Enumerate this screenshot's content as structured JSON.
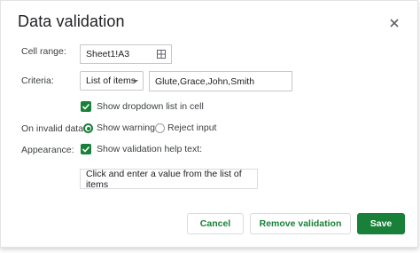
{
  "dialog": {
    "title": "Data validation",
    "close_icon": "close-icon"
  },
  "cell_range": {
    "label": "Cell range:",
    "value": "Sheet1!A3",
    "icon": "grid-icon"
  },
  "criteria": {
    "label": "Criteria:",
    "type": "List of items",
    "items": "Glute,Grace,John,Smith"
  },
  "dropdown_option": {
    "label": "Show dropdown list in cell",
    "checked": true
  },
  "invalid_data": {
    "label": "On invalid data:",
    "options": [
      "Show warning",
      "Reject input"
    ],
    "selected": "Show warning"
  },
  "appearance": {
    "label": "Appearance:",
    "checkbox_label": "Show validation help text:",
    "checked": true,
    "help_text": "Click and enter a value from the list of items"
  },
  "buttons": {
    "cancel": "Cancel",
    "remove": "Remove validation",
    "save": "Save"
  },
  "colors": {
    "accent": "#188038",
    "text": "#3c4043",
    "border": "#c8c8c8"
  }
}
